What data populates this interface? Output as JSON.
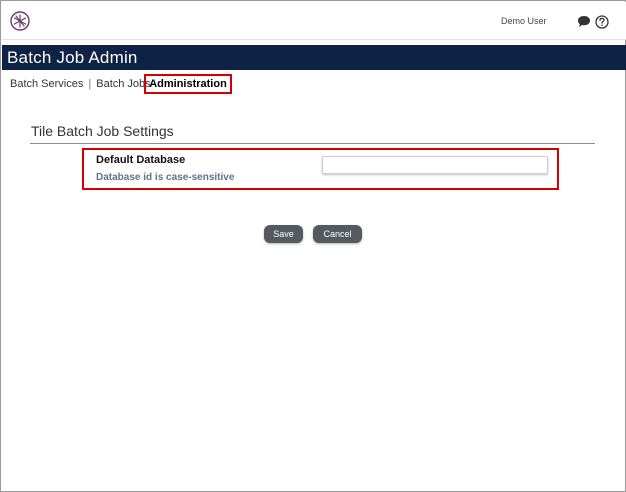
{
  "header": {
    "user_name": "Demo User",
    "logo_icon": "asterisk-logo-icon",
    "chat_icon": "chat-bubble-icon",
    "help_icon": "question-circle-icon"
  },
  "app": {
    "title": "Batch Job Admin",
    "header_color": "#0d2245"
  },
  "breadcrumb": {
    "items": [
      "Batch Services",
      "Batch Jobs"
    ],
    "separator": "|",
    "active": "Administration"
  },
  "section": {
    "title": "Tile Batch Job Settings"
  },
  "field": {
    "label": "Default Database",
    "hint": "Database id is case-sensitive",
    "value": "",
    "placeholder": ""
  },
  "actions": {
    "save_label": "Save",
    "cancel_label": "Cancel"
  },
  "highlight_color": "#d40000"
}
